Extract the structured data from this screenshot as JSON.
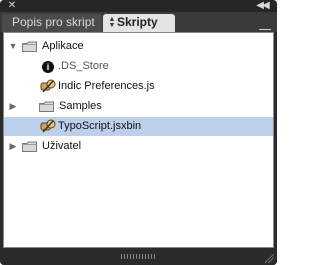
{
  "window": {
    "close_glyph": "✕",
    "collapse_glyph": "◀◀"
  },
  "tabs": [
    {
      "label": "Popis pro skript",
      "active": false
    },
    {
      "label": "Skripty",
      "active": true,
      "arrows_glyph": "⌃⌄"
    }
  ],
  "tree": [
    {
      "label": "Aplikace",
      "type": "folder",
      "level": 0,
      "expanded": true,
      "disclosure": "▼",
      "icon": "folder-icon"
    },
    {
      "label": ".DS_Store",
      "type": "file",
      "level": 1,
      "icon": "info-icon",
      "icon_text": "i"
    },
    {
      "label": "Indic Preferences.js",
      "type": "script",
      "level": 1,
      "icon": "script-icon"
    },
    {
      "label": "Samples",
      "type": "folder",
      "level": 1,
      "expanded": false,
      "disclosure": "▶",
      "icon": "folder-icon"
    },
    {
      "label": "TypoScript.jsxbin",
      "type": "script",
      "level": 1,
      "selected": true,
      "icon": "script-icon"
    },
    {
      "label": "Uživatel",
      "type": "folder",
      "level": 0,
      "expanded": false,
      "disclosure": "▶",
      "icon": "folder-icon"
    }
  ],
  "colors": {
    "selection": "#bcd0ec",
    "panel_chrome": "#2b2b2b",
    "active_tab": "#e4e4e4"
  }
}
